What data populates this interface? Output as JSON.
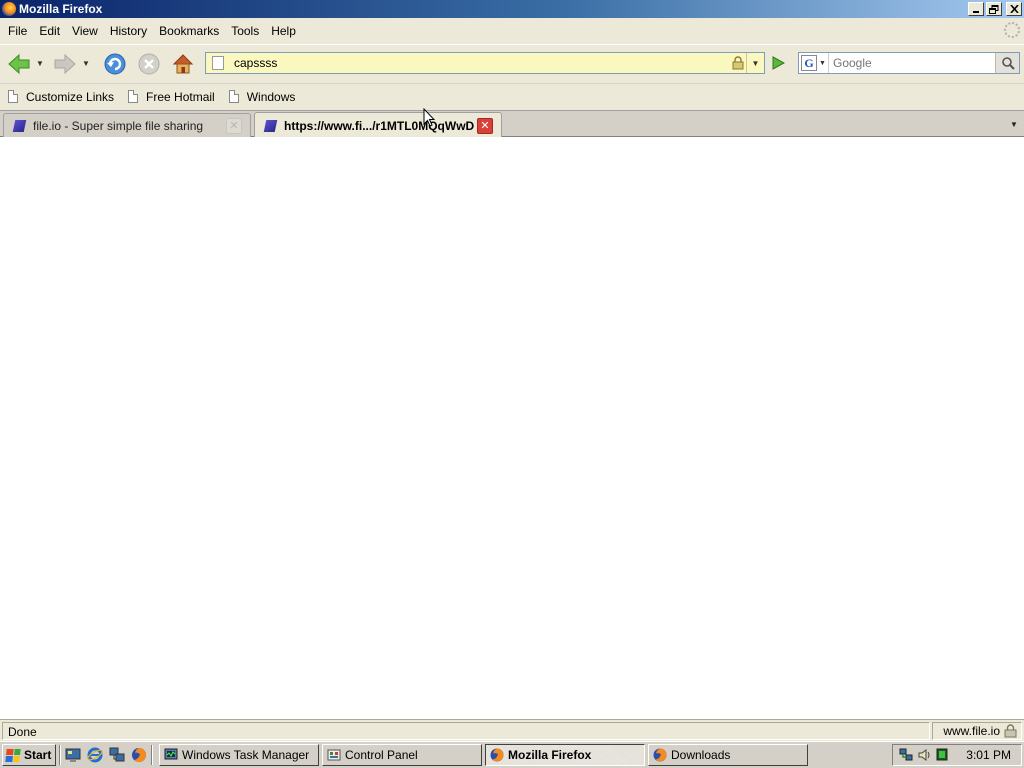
{
  "window": {
    "title": "Mozilla Firefox",
    "controls": [
      "minimize",
      "restore",
      "close"
    ]
  },
  "menu": {
    "items": [
      {
        "label": "File",
        "accesskey": "F"
      },
      {
        "label": "Edit",
        "accesskey": "E"
      },
      {
        "label": "View",
        "accesskey": "V"
      },
      {
        "label": "History",
        "accesskey": "s"
      },
      {
        "label": "Bookmarks",
        "accesskey": "B"
      },
      {
        "label": "Tools",
        "accesskey": "T"
      },
      {
        "label": "Help",
        "accesskey": "H"
      }
    ]
  },
  "navbar": {
    "icons": [
      "back-arrow-icon",
      "forward-arrow-icon",
      "reload-icon",
      "stop-icon",
      "home-icon"
    ],
    "url_value": "capssss",
    "search": {
      "engine": "G",
      "placeholder": "Google"
    }
  },
  "bookmarks": {
    "items": [
      {
        "label": "Customize Links"
      },
      {
        "label": "Free Hotmail"
      },
      {
        "label": "Windows"
      }
    ]
  },
  "tabs": [
    {
      "title": "file.io - Super simple file sharing",
      "active": false
    },
    {
      "title": "https://www.fi.../r1MTL0MQqWwD",
      "active": true
    }
  ],
  "status": {
    "text": "Done",
    "domain": "www.file.io"
  },
  "taskbar": {
    "start_label": "Start",
    "tasks": [
      {
        "label": "Windows Task Manager",
        "active": false
      },
      {
        "label": "Control Panel",
        "active": false
      },
      {
        "label": "Mozilla Firefox",
        "active": true
      },
      {
        "label": "Downloads",
        "active": false
      }
    ],
    "clock": "3:01 PM"
  },
  "colors": {
    "title_gradient_start": "#0a246a",
    "title_gradient_end": "#a6caf0",
    "url_background": "#fbf8bf",
    "tab_close_active": "#d9403a",
    "chrome": "#ece9d8"
  }
}
